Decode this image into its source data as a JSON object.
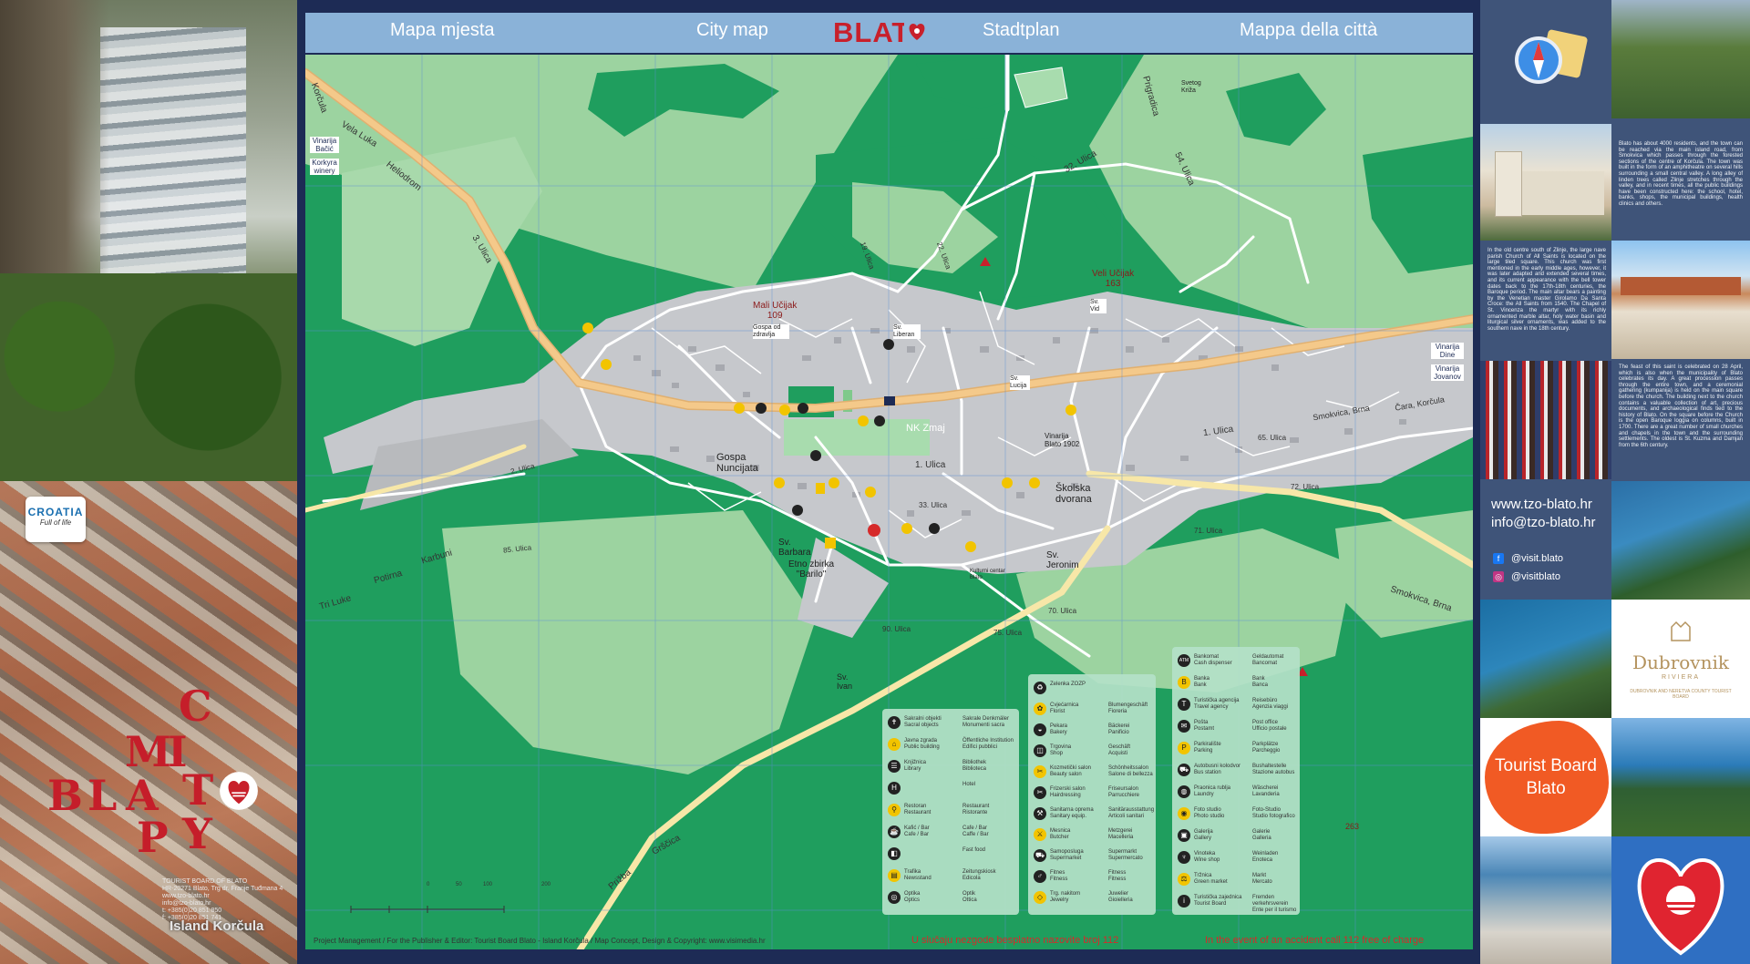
{
  "header": {
    "labels": [
      "Mapa mjesta",
      "City map",
      "BLATO",
      "Stadtplan",
      "Mappa della città"
    ]
  },
  "left_brochure": {
    "brand_line1": "CROATIA",
    "brand_line2": "Full of life",
    "letters": [
      "C",
      "I",
      "M",
      "T",
      "B",
      "L",
      "A",
      "Y",
      "P",
      "Y"
    ],
    "contact": "TOURIST BOARD OF BLATO\nHR-20271 Blato, Trg dr. Franje Tuđmana 4\nwww.tzo-blato.hr\ninfo@tzo-blato.hr\nt: +385(0)20 851 850\nf: +385(0)20 851 741",
    "island": "Island Korčula"
  },
  "map": {
    "streets": [
      "Korčula",
      "Vela Luka",
      "Heliodrom",
      "3. Ulica",
      "Prigradica",
      "32. Ulica",
      "54. Ulica",
      "1. Ulica",
      "1. Ulica",
      "Smokvica, Brna",
      "Čara, Korčula",
      "2. Ulica",
      "85. Ulica",
      "Karbuni",
      "Potirna",
      "Tri Luke",
      "Prižba",
      "Grščica",
      "Smokvica, Brna",
      "33. Ulica",
      "90. Ulica",
      "71. Ulica",
      "65. Ulica",
      "72. Ulica",
      "70. Ulica",
      "75. Ulica",
      "19. Ulica",
      "22. Ulica"
    ],
    "places": [
      {
        "name": "Mali Učijak",
        "height": "109"
      },
      {
        "name": "Veli Učijak",
        "height": "163"
      },
      {
        "name": "Gospa od zdravlja"
      },
      {
        "name": "Sv. Liberan"
      },
      {
        "name": "Sv. Vid"
      },
      {
        "name": "Svetog Križa"
      },
      {
        "name": "NK Zmaj"
      },
      {
        "name": "Gospa Nuncijata"
      },
      {
        "name": "Vinarija Blato 1902"
      },
      {
        "name": "Sv. Lucija"
      },
      {
        "name": "Školska dvorana"
      },
      {
        "name": "Sv. Barbara"
      },
      {
        "name": "Etno zbirka \"Barilo\""
      },
      {
        "name": "Kulturni centar Blato"
      },
      {
        "name": "Sv. Jeronim"
      },
      {
        "name": "Sv. Ivan"
      },
      {
        "name": "Vinarija Bačić"
      },
      {
        "name": "Korkyra winery"
      },
      {
        "name": "Vinarija Dine"
      },
      {
        "name": "Vinarija Jovanov"
      }
    ],
    "peak": {
      "height": "263"
    },
    "scale": [
      "0",
      "50",
      "100",
      "200"
    ],
    "footer_credit": "Project Management / For the Publisher & Editor: Tourist Board Blato - Island Korčula / Map Concept, Design & Copyright: www.visimedia.hr",
    "footer_hr": "U slučaju nezgode besplatno nazovite broj 112",
    "footer_en": "In the event of an accident call 112 free of charge"
  },
  "legend": {
    "col1": [
      {
        "icon": "church-icon",
        "glyph": "✝",
        "c1": "Sakralni objekti\nSacral objects",
        "c2": "Sakrale Denkmäler\nMonumenti sacra"
      },
      {
        "icon": "building-icon",
        "glyph": "⌂",
        "c1": "Javna zgrada\nPublic building",
        "c2": "Öffentliche Institution\nEdifici pubblici"
      },
      {
        "icon": "library-icon",
        "glyph": "☰",
        "c1": "Knjižnica\nLibrary",
        "c2": "Bibliothek\nBiblioteca"
      },
      {
        "icon": "hotel-icon",
        "glyph": "H",
        "c1": "",
        "c2": "Hotel"
      },
      {
        "icon": "restaurant-icon",
        "glyph": "⚲",
        "c1": "Restoran\nRestaurant",
        "c2": "Restaurant\nRistorante"
      },
      {
        "icon": "cafe-icon",
        "glyph": "☕",
        "c1": "Kafić / Bar\nCafe / Bar",
        "c2": "Cafe / Bar\nCaffe / Bar"
      },
      {
        "icon": "fastfood-icon",
        "glyph": "◧",
        "c1": "",
        "c2": "Fast food"
      },
      {
        "icon": "newsstand-icon",
        "glyph": "▤",
        "c1": "Trafika\nNewsstand",
        "c2": "Zeitungskiosk\nEdicola"
      },
      {
        "icon": "optician-icon",
        "glyph": "◎",
        "c1": "Optika\nOptics",
        "c2": "Optik\nOttica"
      }
    ],
    "col2": [
      {
        "icon": "recycling-icon",
        "glyph": "♻",
        "c1": "Zelenka ZOZP",
        "c2": ""
      },
      {
        "icon": "florist-icon",
        "glyph": "✿",
        "c1": "Cvjećarnica\nFlorist",
        "c2": "Blumengeschäft\nFioreria"
      },
      {
        "icon": "bakery-icon",
        "glyph": "◒",
        "c1": "Pekara\nBakery",
        "c2": "Bäckerei\nPanificio"
      },
      {
        "icon": "shop-icon",
        "glyph": "◫",
        "c1": "Trgovina\nShop",
        "c2": "Geschäft\nAcquisti"
      },
      {
        "icon": "beauty-icon",
        "glyph": "✂",
        "c1": "Kozmetički salon\nBeauty salon",
        "c2": "Schönheitssalon\nSalone di bellezza"
      },
      {
        "icon": "hairdresser-icon",
        "glyph": "✂",
        "c1": "Frizerski salon\nHairdressing",
        "c2": "Friseursalon\nParrucchiere"
      },
      {
        "icon": "sanitary-icon",
        "glyph": "⚒",
        "c1": "Sanitarna oprema\nSanitary equip.",
        "c2": "Sanitärausstattung\nArticoli sanitari"
      },
      {
        "icon": "butcher-icon",
        "glyph": "⚔",
        "c1": "Mesnica\nButcher",
        "c2": "Metzgerei\nMacelleria"
      },
      {
        "icon": "supermarket-icon",
        "glyph": "⛟",
        "c1": "Samoposluga\nSupermarket",
        "c2": "Supermarkt\nSupermercato"
      },
      {
        "icon": "fitness-icon",
        "glyph": "♂",
        "c1": "Fitnes\nFitness",
        "c2": "Fitness\nFitness"
      },
      {
        "icon": "jewelry-icon",
        "glyph": "◇",
        "c1": "Trg. nakitom\nJewelry",
        "c2": "Juwelier\nGioielleria"
      }
    ],
    "col3": [
      {
        "icon": "atm-icon",
        "glyph": "ATM",
        "c1": "Bankomat\nCash dispenser",
        "c2": "Geldautomat\nBancomat"
      },
      {
        "icon": "bank-icon",
        "glyph": "B",
        "c1": "Banka\nBank",
        "c2": "Bank\nBanca"
      },
      {
        "icon": "travel-agency-icon",
        "glyph": "T",
        "c1": "Turistička agencija\nTravel agency",
        "c2": "Reisebüro\nAgenzia viaggi"
      },
      {
        "icon": "post-office-icon",
        "glyph": "✉",
        "c1": "Pošta\nPostamt",
        "c2": "Post office\nUfficio postale"
      },
      {
        "icon": "parking-icon",
        "glyph": "P",
        "c1": "Parkiralište\nParking",
        "c2": "Parkplätze\nParcheggio"
      },
      {
        "icon": "bus-station-icon",
        "glyph": "⛟",
        "c1": "Autobusni kolodvor\nBus station",
        "c2": "Bushaltestelle\nStazione autobus"
      },
      {
        "icon": "laundry-icon",
        "glyph": "◍",
        "c1": "Praonica rublja\nLaundry",
        "c2": "Wäscherei\nLavanderia"
      },
      {
        "icon": "photo-studio-icon",
        "glyph": "◉",
        "c1": "Foto studio\nPhoto studio",
        "c2": "Foto-Studio\nStudio fotografico"
      },
      {
        "icon": "gallery-icon",
        "glyph": "▣",
        "c1": "Galerija\nGallery",
        "c2": "Galerie\nGalleria"
      },
      {
        "icon": "wine-shop-icon",
        "glyph": "♆",
        "c1": "Vinoteka\nWine shop",
        "c2": "Weinladen\nEnoteca"
      },
      {
        "icon": "market-icon",
        "glyph": "⚖",
        "c1": "Tržnica\nGreen market",
        "c2": "Markt\nMercato"
      },
      {
        "icon": "tourist-board-icon",
        "glyph": "i",
        "c1": "Turistička zajednica\nTourist Board",
        "c2": "Fremden verkehrsverein\nEnte per il turismo"
      }
    ]
  },
  "right_column": {
    "text1": "Blato has about 4000 residents, and the town can be reached via the main island road, from Smokvica which passes through the forested sections of the centre of Korčula. The town was built in the form of an amphitheatre on several hills surrounding a small central valley. A long alley of linden trees called Zlinje stretches through the valley, and in recent times, all the public buildings have been constructed here: the school, hotel, banks, shops, the municipal buildings, health clinics and others.",
    "text2": "In the old centre south of Zlinje, the large nave parish Church of All Saints is located on the large tiled square. This church was first mentioned in the early middle ages, however, it was later adapted and extended several times, and its current appearance with the bell tower dates back to the 17th-18th centuries, the Baroque period. The main altar bears a painting by the Venetian master Girolamo Da Santa Croce: the All Saints from 1540. The Chapel of St. Vincenza the martyr with its richly ornamented marble altar, holy water basin and liturgical silver ornaments, was added to the southern nave in the 18th century.",
    "text3": "The feast of this saint is celebrated on 28 April, which is also when the municipality of Blato celebrates its day. A great procession passes through the entire town, and a ceremonial gathering (kumpanija) is held on the main square before the church. The building next to the church contains a valuable collection of art, precious documents, and archaeological finds tied to the history of Blato. On the square before the Church is the open Baroque loggia on columns, built in 1700. There are a great number of small churches and chapels in the town and the surrounding settlements. The oldest is St. Kuzma and Damjan from the 6th century.",
    "web": "www.tzo-blato.hr",
    "email": "info@tzo-blato.hr",
    "facebook": "@visit.blato",
    "instagram": "@visitblato",
    "tourist_board": [
      "Tourist Board",
      "Blato"
    ],
    "dubrovnik_title": "Dubrovnik",
    "dubrovnik_sub": "RIVIERA",
    "dubrovnik_sub2": "DUBROVNIK AND NERETVA COUNTY TOURIST BOARD"
  },
  "colors": {
    "frame": "#1d2b55",
    "forest": "#1f9e5e",
    "light_green": "#9cd3a0",
    "urban": "#c6c8cc",
    "road": "#f4c98a",
    "header": "#8ab2d8",
    "brand_red": "#c8202b",
    "right_bg": "#3f5479",
    "tourist_board_orange": "#f15a24"
  }
}
